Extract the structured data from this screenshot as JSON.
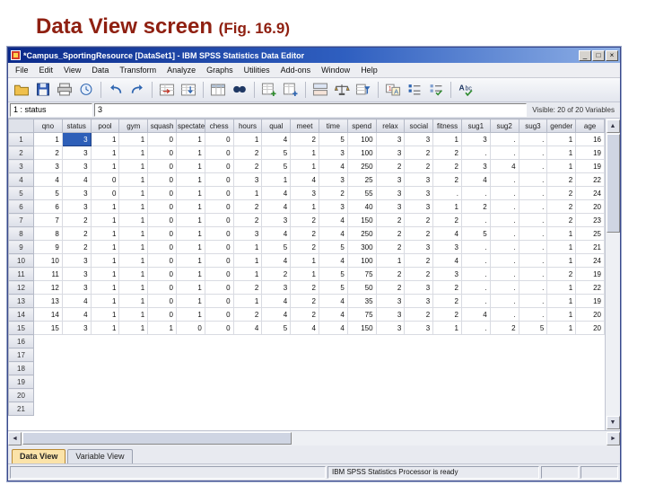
{
  "slide": {
    "title": "Data View screen ",
    "fig": "(Fig. 16.9)"
  },
  "window": {
    "title": "*Campus_SportingResource [DataSet1] - IBM SPSS Statistics Data Editor",
    "controls": {
      "minimize": "_",
      "maximize": "□",
      "close": "×"
    }
  },
  "menubar": {
    "items": [
      "File",
      "Edit",
      "View",
      "Data",
      "Transform",
      "Analyze",
      "Graphs",
      "Utilities",
      "Add-ons",
      "Window",
      "Help"
    ]
  },
  "toolbar": {
    "icons": [
      {
        "name": "open-data-icon"
      },
      {
        "name": "save-icon"
      },
      {
        "name": "print-icon"
      },
      {
        "name": "recall-dialogs-icon"
      },
      {
        "type": "separator"
      },
      {
        "name": "undo-icon"
      },
      {
        "name": "redo-icon"
      },
      {
        "type": "separator"
      },
      {
        "name": "goto-case-icon"
      },
      {
        "name": "goto-variable-icon"
      },
      {
        "type": "separator"
      },
      {
        "name": "variables-icon"
      },
      {
        "name": "find-icon"
      },
      {
        "type": "separator"
      },
      {
        "name": "insert-cases-icon"
      },
      {
        "name": "insert-variable-icon"
      },
      {
        "type": "separator"
      },
      {
        "name": "split-file-icon"
      },
      {
        "name": "weight-cases-icon"
      },
      {
        "name": "select-cases-icon"
      },
      {
        "type": "separator"
      },
      {
        "name": "value-labels-icon"
      },
      {
        "name": "use-variable-sets-icon"
      },
      {
        "name": "show-all-variables-icon"
      },
      {
        "type": "separator"
      },
      {
        "name": "spell-check-icon"
      }
    ]
  },
  "cellref": {
    "label": "1 : status",
    "value": "3",
    "visible": "Visible: 20 of 20 Variables"
  },
  "grid": {
    "columns": [
      "qno",
      "status",
      "pool",
      "gym",
      "squash",
      "spectate",
      "chess",
      "hours",
      "qual",
      "meet",
      "time",
      "spend",
      "relax",
      "social",
      "fitness",
      "sug1",
      "sug2",
      "sug3",
      "gender",
      "age"
    ],
    "rows": [
      [
        "1",
        "3",
        "1",
        "1",
        "0",
        "1",
        "0",
        "1",
        "4",
        "2",
        "5",
        "100",
        "3",
        "3",
        "1",
        "3",
        ".",
        ".",
        "1",
        "16"
      ],
      [
        "2",
        "3",
        "1",
        "1",
        "0",
        "1",
        "0",
        "2",
        "5",
        "1",
        "3",
        "100",
        "3",
        "2",
        "2",
        ".",
        ".",
        ".",
        "1",
        "19"
      ],
      [
        "3",
        "3",
        "1",
        "1",
        "0",
        "1",
        "0",
        "2",
        "5",
        "1",
        "4",
        "250",
        "2",
        "2",
        "2",
        "3",
        "4",
        ".",
        "1",
        "19"
      ],
      [
        "4",
        "4",
        "0",
        "1",
        "0",
        "1",
        "0",
        "3",
        "1",
        "4",
        "3",
        "25",
        "3",
        "3",
        "2",
        "4",
        ".",
        ".",
        "2",
        "22"
      ],
      [
        "5",
        "3",
        "0",
        "1",
        "0",
        "1",
        "0",
        "1",
        "4",
        "3",
        "2",
        "55",
        "3",
        "3",
        ".",
        ".",
        ".",
        ".",
        "2",
        "24"
      ],
      [
        "6",
        "3",
        "1",
        "1",
        "0",
        "1",
        "0",
        "2",
        "4",
        "1",
        "3",
        "40",
        "3",
        "3",
        "1",
        "2",
        ".",
        ".",
        "2",
        "20"
      ],
      [
        "7",
        "2",
        "1",
        "1",
        "0",
        "1",
        "0",
        "2",
        "3",
        "2",
        "4",
        "150",
        "2",
        "2",
        "2",
        ".",
        ".",
        ".",
        "2",
        "23"
      ],
      [
        "8",
        "2",
        "1",
        "1",
        "0",
        "1",
        "0",
        "3",
        "4",
        "2",
        "4",
        "250",
        "2",
        "2",
        "4",
        "5",
        ".",
        ".",
        "1",
        "25"
      ],
      [
        "9",
        "2",
        "1",
        "1",
        "0",
        "1",
        "0",
        "1",
        "5",
        "2",
        "5",
        "300",
        "2",
        "3",
        "3",
        ".",
        ".",
        ".",
        "1",
        "21"
      ],
      [
        "10",
        "3",
        "1",
        "1",
        "0",
        "1",
        "0",
        "1",
        "4",
        "1",
        "4",
        "100",
        "1",
        "2",
        "4",
        ".",
        ".",
        ".",
        "1",
        "24"
      ],
      [
        "11",
        "3",
        "1",
        "1",
        "0",
        "1",
        "0",
        "1",
        "2",
        "1",
        "5",
        "75",
        "2",
        "2",
        "3",
        ".",
        ".",
        ".",
        "2",
        "19"
      ],
      [
        "12",
        "3",
        "1",
        "1",
        "0",
        "1",
        "0",
        "2",
        "3",
        "2",
        "5",
        "50",
        "2",
        "3",
        "2",
        ".",
        ".",
        ".",
        "1",
        "22"
      ],
      [
        "13",
        "4",
        "1",
        "1",
        "0",
        "1",
        "0",
        "1",
        "4",
        "2",
        "4",
        "35",
        "3",
        "3",
        "2",
        ".",
        ".",
        ".",
        "1",
        "19"
      ],
      [
        "14",
        "4",
        "1",
        "1",
        "0",
        "1",
        "0",
        "2",
        "4",
        "2",
        "4",
        "75",
        "3",
        "2",
        "2",
        "4",
        ".",
        ".",
        "1",
        "20"
      ],
      [
        "15",
        "3",
        "1",
        "1",
        "1",
        "0",
        "0",
        "4",
        "5",
        "4",
        "4",
        "150",
        "3",
        "3",
        "1",
        ".",
        "2",
        "5",
        "1",
        "20"
      ]
    ],
    "empty_row_numbers": [
      "16",
      "17",
      "18",
      "19",
      "20",
      "21"
    ],
    "selected": {
      "row_index": 0,
      "col_index": 1
    }
  },
  "icons": {
    "scroll_up": "▲",
    "scroll_down": "▼",
    "scroll_left": "◄",
    "scroll_right": "►"
  },
  "tabs": {
    "data_view": "Data View",
    "variable_view": "Variable View"
  },
  "statusbar": {
    "text": "IBM SPSS Statistics Processor is ready"
  },
  "colors": {
    "titlebar_blue": "#0b2a8a",
    "selection_blue": "#2e5fb8",
    "active_tab": "#fbe3a9",
    "slide_title_red": "#8f2011"
  }
}
